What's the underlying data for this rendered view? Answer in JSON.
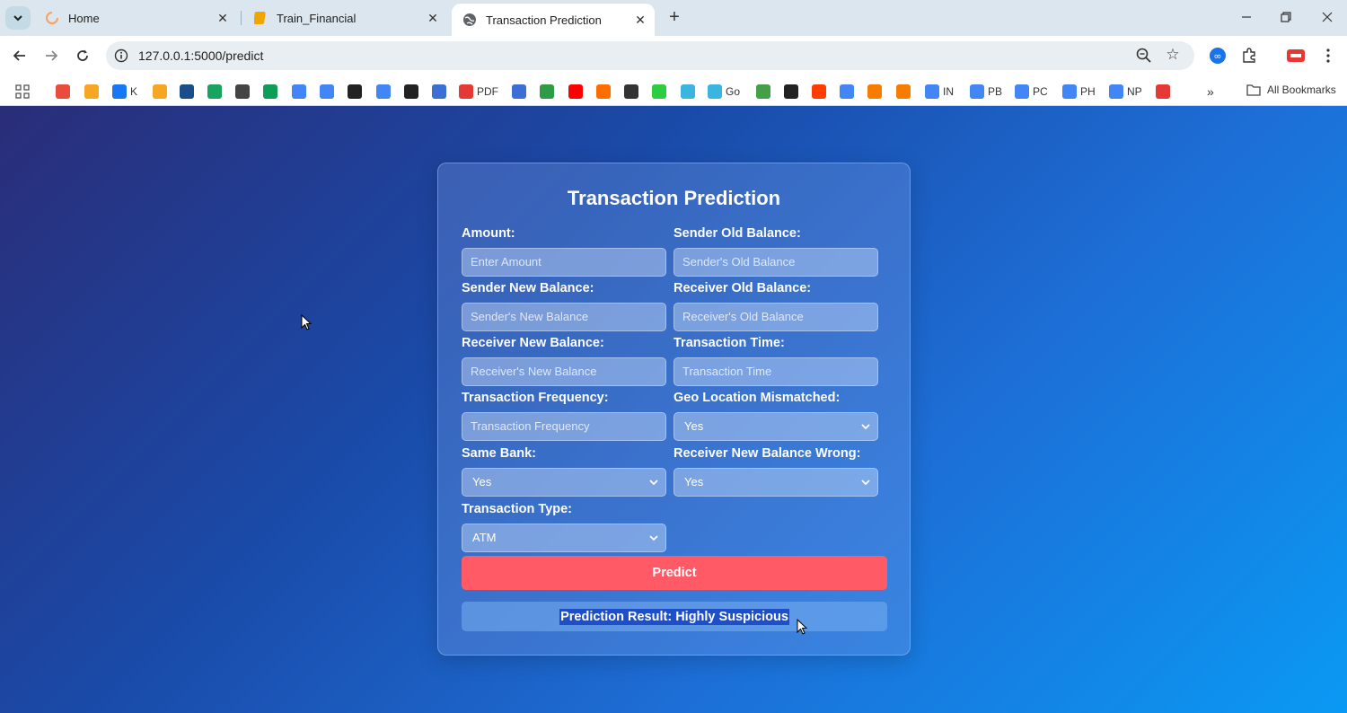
{
  "browser": {
    "tabs": [
      {
        "title": "Home",
        "icon": "loading-ring-icon",
        "active": false
      },
      {
        "title": "Train_Financial",
        "icon": "notebook-icon",
        "active": false
      },
      {
        "title": "Transaction Prediction",
        "icon": "globe-icon",
        "active": true
      }
    ],
    "url": "127.0.0.1:5000/predict",
    "bookmarks": [
      {
        "label": "",
        "icon": "arrows-icon",
        "color": "#e84c3d"
      },
      {
        "label": "",
        "icon": "square-b-icon",
        "color": "#f5a623"
      },
      {
        "label": "K",
        "icon": "facebook-icon",
        "color": "#1877f2"
      },
      {
        "label": "",
        "icon": "bars-icon",
        "color": "#f5a623"
      },
      {
        "label": "",
        "icon": "ieee-icon",
        "color": "#1a4d8c"
      },
      {
        "label": "",
        "icon": "circle-16-icon",
        "color": "#1aa260"
      },
      {
        "label": "",
        "icon": "globe-icon",
        "color": "#444444"
      },
      {
        "label": "",
        "icon": "sheets-icon",
        "color": "#0f9d58"
      },
      {
        "label": "",
        "icon": "google-icon",
        "color": "#4285f4"
      },
      {
        "label": "",
        "icon": "google-icon",
        "color": "#4285f4"
      },
      {
        "label": "",
        "icon": "github-icon",
        "color": "#222222"
      },
      {
        "label": "",
        "icon": "google-icon",
        "color": "#4285f4"
      },
      {
        "label": "",
        "icon": "openai-icon",
        "color": "#222222"
      },
      {
        "label": "",
        "icon": "bird-icon",
        "color": "#3b6fd6"
      },
      {
        "label": "PDF",
        "icon": "pdf-icon",
        "color": "#e53935"
      },
      {
        "label": "",
        "icon": "frame-icon",
        "color": "#3b6fd6"
      },
      {
        "label": "",
        "icon": "android-icon",
        "color": "#2e9b45"
      },
      {
        "label": "",
        "icon": "youtube-icon",
        "color": "#ff0000"
      },
      {
        "label": "",
        "icon": "z-icon",
        "color": "#ff6d00"
      },
      {
        "label": "",
        "icon": "oval-icon",
        "color": "#333333"
      },
      {
        "label": "",
        "icon": "ring-icon",
        "color": "#2ecc40"
      },
      {
        "label": "",
        "icon": "heart-icon",
        "color": "#39b5e0"
      },
      {
        "label": "Go",
        "icon": "heart-icon",
        "color": "#39b5e0"
      },
      {
        "label": "",
        "icon": "leaf-icon",
        "color": "#43a047"
      },
      {
        "label": "",
        "icon": "cp-icon",
        "color": "#222222"
      },
      {
        "label": "",
        "icon": "red-badge-icon",
        "color": "#ff3d00"
      },
      {
        "label": "",
        "icon": "google-icon",
        "color": "#4285f4"
      },
      {
        "label": "",
        "icon": "kaggle-triangle-icon",
        "color": "#f57c00"
      },
      {
        "label": "",
        "icon": "flower-icon",
        "color": "#f57c00"
      },
      {
        "label": "IN",
        "icon": "google-icon",
        "color": "#4285f4"
      },
      {
        "label": "PB",
        "icon": "google-icon",
        "color": "#4285f4"
      },
      {
        "label": "PC",
        "icon": "google-icon",
        "color": "#4285f4"
      },
      {
        "label": "PH",
        "icon": "google-icon",
        "color": "#4285f4"
      },
      {
        "label": "NP",
        "icon": "google-icon",
        "color": "#4285f4"
      },
      {
        "label": "",
        "icon": "office-icon",
        "color": "#e53935"
      }
    ],
    "all_bookmarks": "All Bookmarks"
  },
  "form": {
    "title": "Transaction Prediction",
    "fields": {
      "amount": {
        "label": "Amount:",
        "placeholder": "Enter Amount"
      },
      "sender_old": {
        "label": "Sender Old Balance:",
        "placeholder": "Sender's Old Balance"
      },
      "sender_new": {
        "label": "Sender New Balance:",
        "placeholder": "Sender's New Balance"
      },
      "receiver_old": {
        "label": "Receiver Old Balance:",
        "placeholder": "Receiver's Old Balance"
      },
      "receiver_new": {
        "label": "Receiver New Balance:",
        "placeholder": "Receiver's New Balance"
      },
      "txn_time": {
        "label": "Transaction Time:",
        "placeholder": "Transaction Time"
      },
      "txn_freq": {
        "label": "Transaction Frequency:",
        "placeholder": "Transaction Frequency"
      },
      "geo_mismatch": {
        "label": "Geo Location Mismatched:",
        "value": "Yes"
      },
      "same_bank": {
        "label": "Same Bank:",
        "value": "Yes"
      },
      "receiver_wrong": {
        "label": "Receiver New Balance Wrong:",
        "value": "Yes"
      },
      "txn_type": {
        "label": "Transaction Type:",
        "value": "ATM"
      }
    },
    "predict_label": "Predict",
    "result_text": "Prediction Result: Highly Suspicious"
  },
  "colors": {
    "predict_button": "#ff5a66",
    "page_gradient_start": "#2a2d78",
    "page_gradient_end": "#0a99f4"
  }
}
